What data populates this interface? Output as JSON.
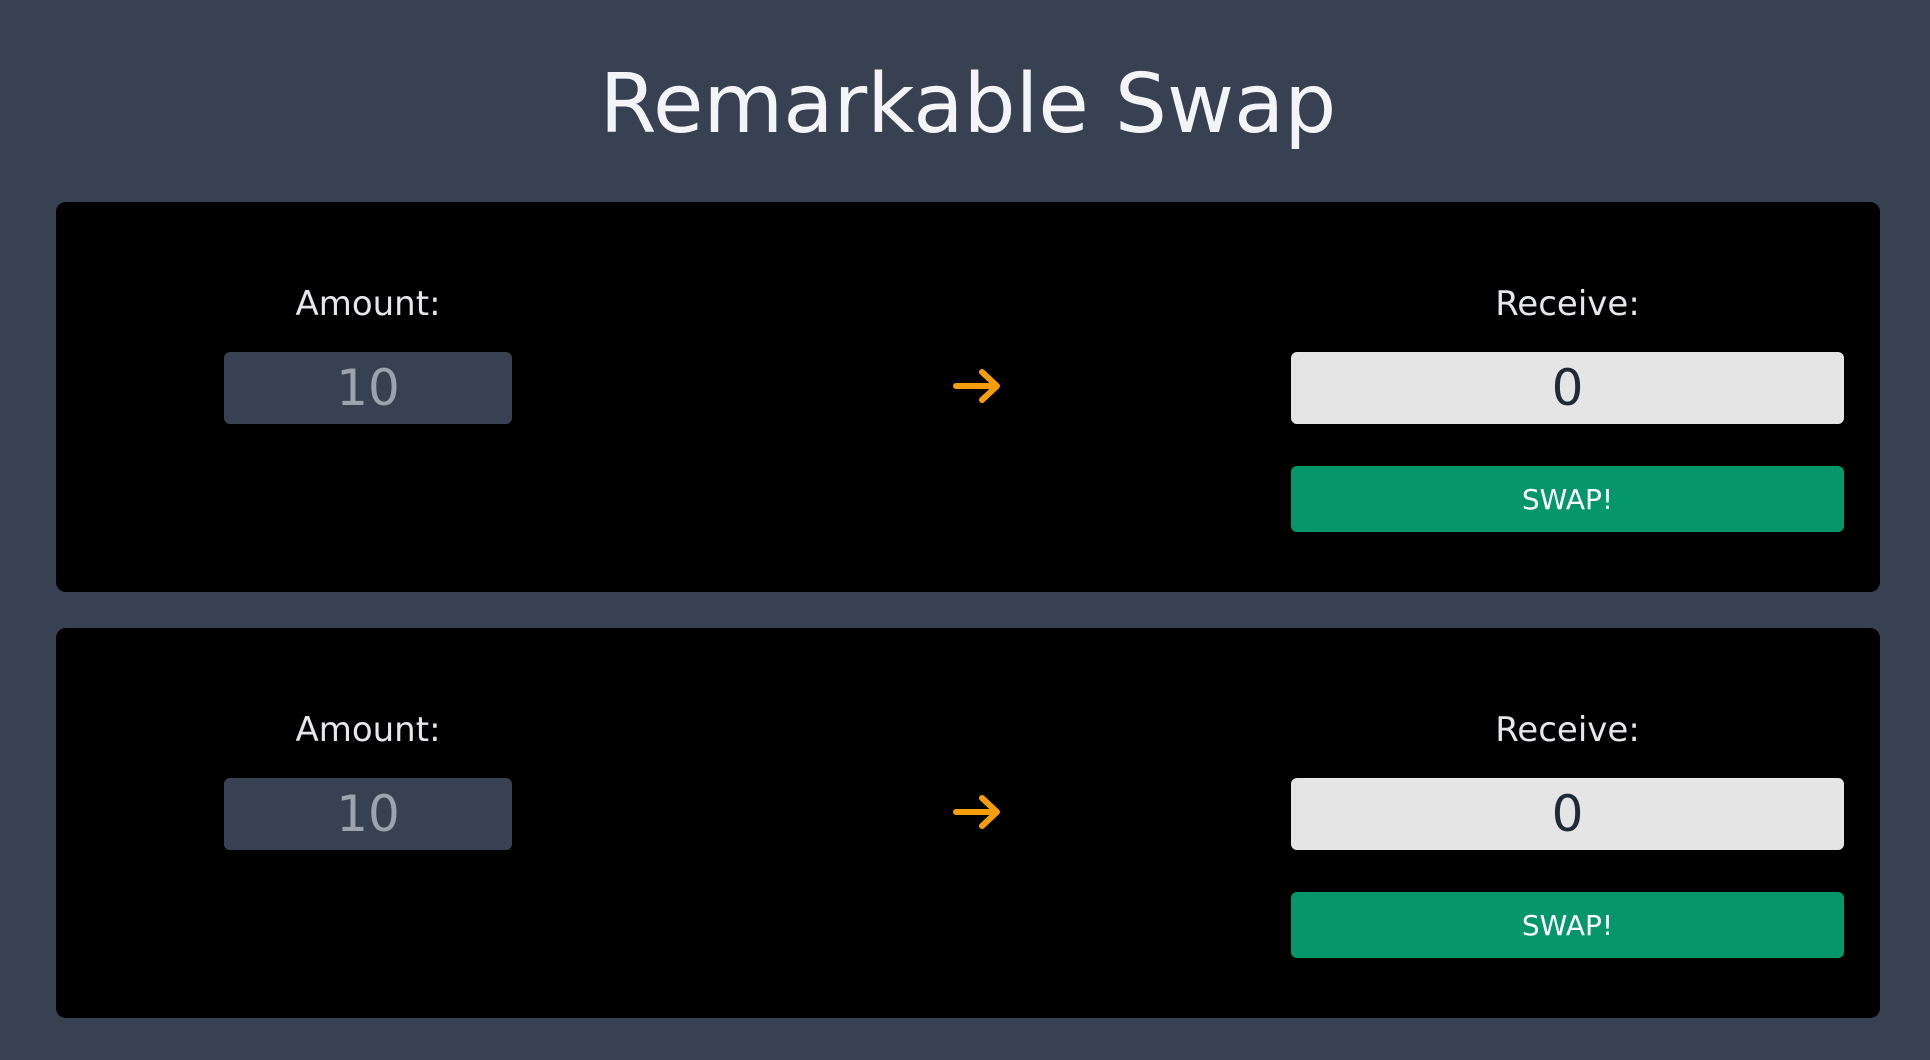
{
  "header": {
    "title": "Remarkable Swap"
  },
  "colors": {
    "background": "#374151",
    "card": "#000000",
    "accent_arrow": "#f59e0b",
    "swap_button": "#059669",
    "receive_field": "#e5e5e5"
  },
  "swaps": [
    {
      "amount_label": "Amount:",
      "amount_value": "10",
      "arrow_icon": "arrow-right-icon",
      "receive_label": "Receive:",
      "receive_value": "0",
      "swap_label": "SWAP!"
    },
    {
      "amount_label": "Amount:",
      "amount_value": "10",
      "arrow_icon": "arrow-right-icon",
      "receive_label": "Receive:",
      "receive_value": "0",
      "swap_label": "SWAP!"
    }
  ]
}
